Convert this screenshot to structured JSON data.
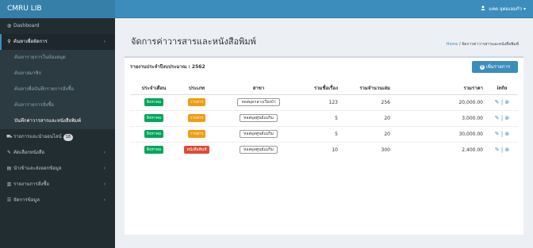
{
  "app": {
    "title": "CMRU LIB",
    "user_name": "แคต อุตมเอมกัว"
  },
  "colors": {
    "topbar": "#3c8dbc",
    "sidebar": "#222d32",
    "green": "#00a65a",
    "orange": "#f39c12",
    "red": "#dd4b39"
  },
  "sidebar": {
    "items": [
      {
        "label": "Dashboard",
        "icon": "dashboard-icon"
      },
      {
        "label": "ค้นหาเพื่อจัดการ",
        "icon": "search-icon"
      },
      {
        "label": "ค้นหารายการในห้องสมุด"
      },
      {
        "label": "ค้นหาสมาชิก"
      },
      {
        "label": "ค้นหาเพื่อบันทึกรายการสั่งซื้อ"
      },
      {
        "label": "ค้นหารายการสั่งซื้อ"
      },
      {
        "label": "บันทึกค่าวารสารและหนังสือพิมพ์"
      },
      {
        "label": "รายการและนำออนไลน์",
        "badge": "18",
        "icon": "cart-icon"
      },
      {
        "label": "คัดเลือกหนังสือ",
        "icon": "edit-icon"
      },
      {
        "label": "นำเข้าและส่งออกข้อมูล",
        "icon": "database-icon"
      },
      {
        "label": "รายงานการสั่งซื้อ",
        "icon": "bar-chart-icon"
      },
      {
        "label": "จัดการข้อมูล",
        "icon": "sliders-icon"
      }
    ]
  },
  "page": {
    "title": "จัดการค่าวารสารและหนังสือพิมพ์"
  },
  "breadcrumb": {
    "home": "Home",
    "sep": "/",
    "current": "จัดการค่าวารสารและหนังสือพิมพ์"
  },
  "box": {
    "title": "รายงานประจำปีงบประมาณ : 2562",
    "add_button": "เพิ่มรายการ"
  },
  "table": {
    "headers": [
      "ประจำเดือน",
      "ประเภท",
      "สาขา",
      "รวมชื่อเรื่อง",
      "รวมจำนวนเล่ม",
      "รวมราคา",
      "info"
    ],
    "rows": [
      {
        "month": "สิงหาคม",
        "type": "วารสาร",
        "type_color": "#f39c12",
        "branch": "หอสมุดกลางเวียงบัว",
        "titles": "123",
        "volumes": "256",
        "price": "20,000.00"
      },
      {
        "month": "สิงหาคม",
        "type": "วารสาร",
        "type_color": "#f39c12",
        "branch": "หอสมุดศูนย์แม่ริม",
        "titles": "5",
        "volumes": "20",
        "price": "3,000.00"
      },
      {
        "month": "สิงหาคม",
        "type": "วารสาร",
        "type_color": "#f39c12",
        "branch": "หอสมุดศูนย์แม่ริม",
        "titles": "5",
        "volumes": "20",
        "price": "30,000.00"
      },
      {
        "month": "สิงหาคม",
        "type": "หนังสือพิมพ์",
        "type_color": "#dd4b39",
        "branch": "หอสมุดศูนย์แม่ริม",
        "titles": "10",
        "volumes": "300",
        "price": "2,400.00"
      }
    ]
  }
}
